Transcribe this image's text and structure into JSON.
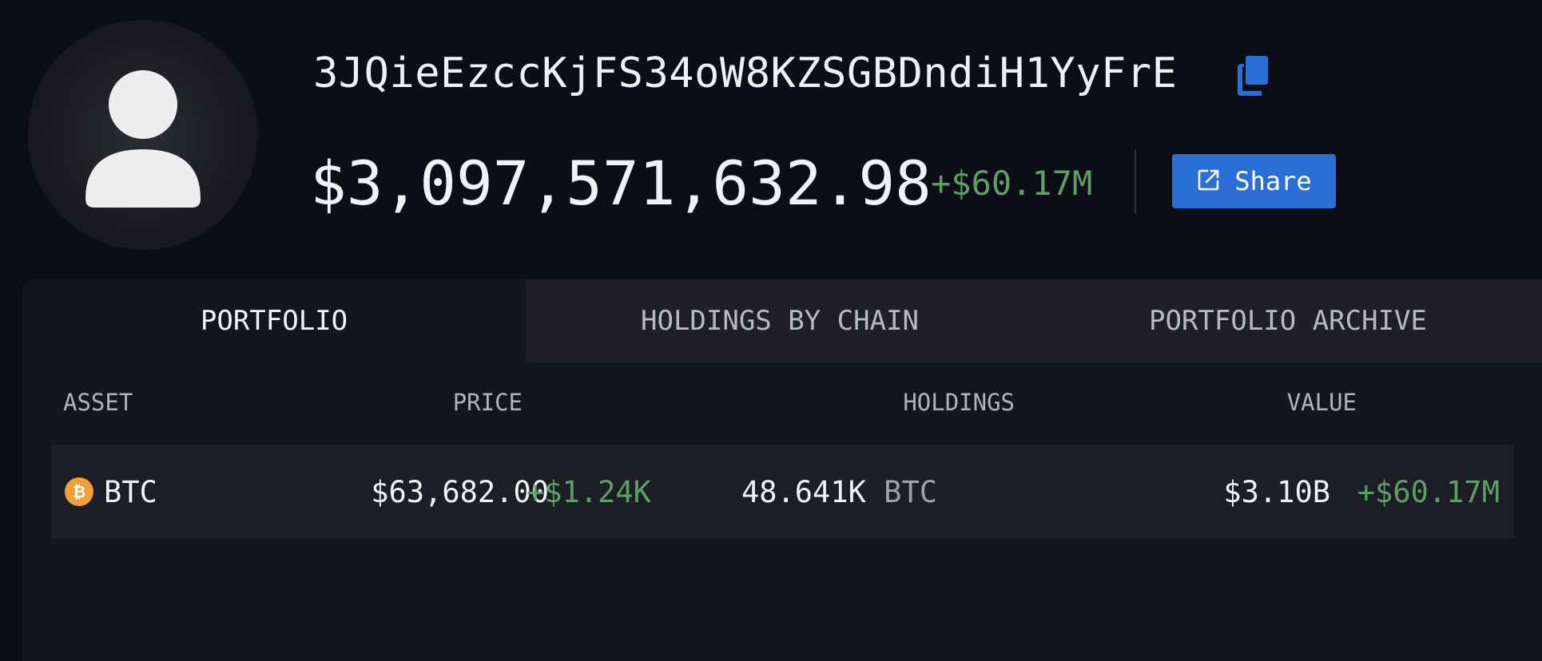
{
  "profile": {
    "address": "3JQieEzccKjFS34oW8KZSGBDndiH1YyFrE",
    "total_value": "$3,097,571,632.98",
    "total_change": "+$60.17M",
    "share_label": "Share",
    "icons": {
      "avatar": "user-silhouette-icon",
      "copy": "copy-icon",
      "share": "external-link-icon"
    },
    "colors": {
      "accent": "#2a6fd6",
      "positive": "#5f9e66"
    }
  },
  "tabs": [
    {
      "label": "PORTFOLIO",
      "active": true
    },
    {
      "label": "HOLDINGS BY CHAIN",
      "active": false
    },
    {
      "label": "PORTFOLIO ARCHIVE",
      "active": false
    }
  ],
  "table": {
    "columns": [
      "ASSET",
      "PRICE",
      "HOLDINGS",
      "VALUE"
    ],
    "rows": [
      {
        "asset": "BTC",
        "asset_icon": "bitcoin-icon",
        "price": "$63,682.00",
        "price_change": "+$1.24K",
        "holdings": "48.641K",
        "holdings_unit": "BTC",
        "value": "$3.10B",
        "value_change": "+$60.17M"
      }
    ]
  }
}
